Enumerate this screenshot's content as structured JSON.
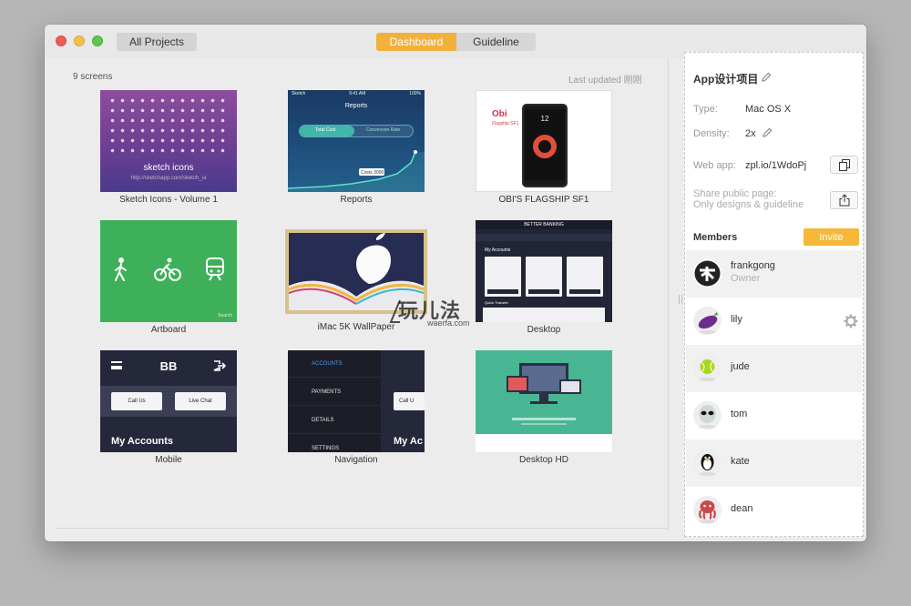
{
  "toolbar": {
    "all_projects_label": "All Projects",
    "tabs": [
      {
        "label": "Dashboard",
        "active": true
      },
      {
        "label": "Guideline",
        "active": false
      }
    ]
  },
  "main": {
    "screens_count": "9 screens",
    "last_updated": "Last updated 刚刚",
    "screens": [
      {
        "label": "Sketch Icons - Volume 1",
        "thumb_title": "sketch icons",
        "thumb_sub": "http://sketchapp.com/sketch_ui"
      },
      {
        "label": "Reports",
        "thumb_title": "Reports",
        "thumb_carrier": "Sketch",
        "thumb_time": "9:41 AM",
        "thumb_battery": "100%",
        "thumb_tab_on": "Total Cost",
        "thumb_tab_off": "Conversion Rate",
        "thumb_tag": "Costs 3000"
      },
      {
        "label": "OBI'S FLAGSHIP SF1",
        "thumb_brand": "Obi",
        "thumb_brand_sub": "Flagship SF1",
        "thumb_time": "12"
      },
      {
        "label": "Artboard",
        "thumb_search": "Search"
      },
      {
        "label": "iMac 5K WallPaper"
      },
      {
        "label": "Desktop",
        "thumb_title": "BETTER BANKING",
        "thumb_accounts": "My Accounts",
        "thumb_quick": "Quick Transfer"
      },
      {
        "label": "Mobile",
        "thumb_title": "BB",
        "thumb_call": "Call Us",
        "thumb_chat": "Live Chat",
        "thumb_accounts": "My Accounts"
      },
      {
        "label": "Navigation",
        "thumb_items": [
          "ACCOUNTS",
          "PAYMENTS",
          "DETAILS",
          "SETTINGS"
        ],
        "thumb_peek_call": "Call U",
        "thumb_peek_acc": "My Ac"
      },
      {
        "label": "Desktop HD"
      }
    ]
  },
  "panel": {
    "project_title": "App设计项目",
    "type_label": "Type:",
    "type_value": "Mac OS X",
    "density_label": "Density:",
    "density_value": "2x",
    "webapp_label": "Web app:",
    "webapp_value": "zpl.io/1WdoPj",
    "share_line1": "Share public page:",
    "share_line2": "Only designs & guideline",
    "members_title": "Members",
    "invite_label": "Invite",
    "members": [
      {
        "name": "frankgong",
        "role": "Owner",
        "avatar": "logo-icon"
      },
      {
        "name": "lily",
        "role": "",
        "avatar": "eggplant-icon"
      },
      {
        "name": "jude",
        "role": "",
        "avatar": "tennis-ball-icon"
      },
      {
        "name": "tom",
        "role": "",
        "avatar": "alien-icon"
      },
      {
        "name": "kate",
        "role": "",
        "avatar": "penguin-icon"
      },
      {
        "name": "dean",
        "role": "",
        "avatar": "octopus-icon"
      }
    ]
  },
  "watermark": {
    "cn": "玩儿法",
    "en": "waerfa.com"
  },
  "colors": {
    "accent": "#f1b13b",
    "invite": "#f6b839"
  }
}
